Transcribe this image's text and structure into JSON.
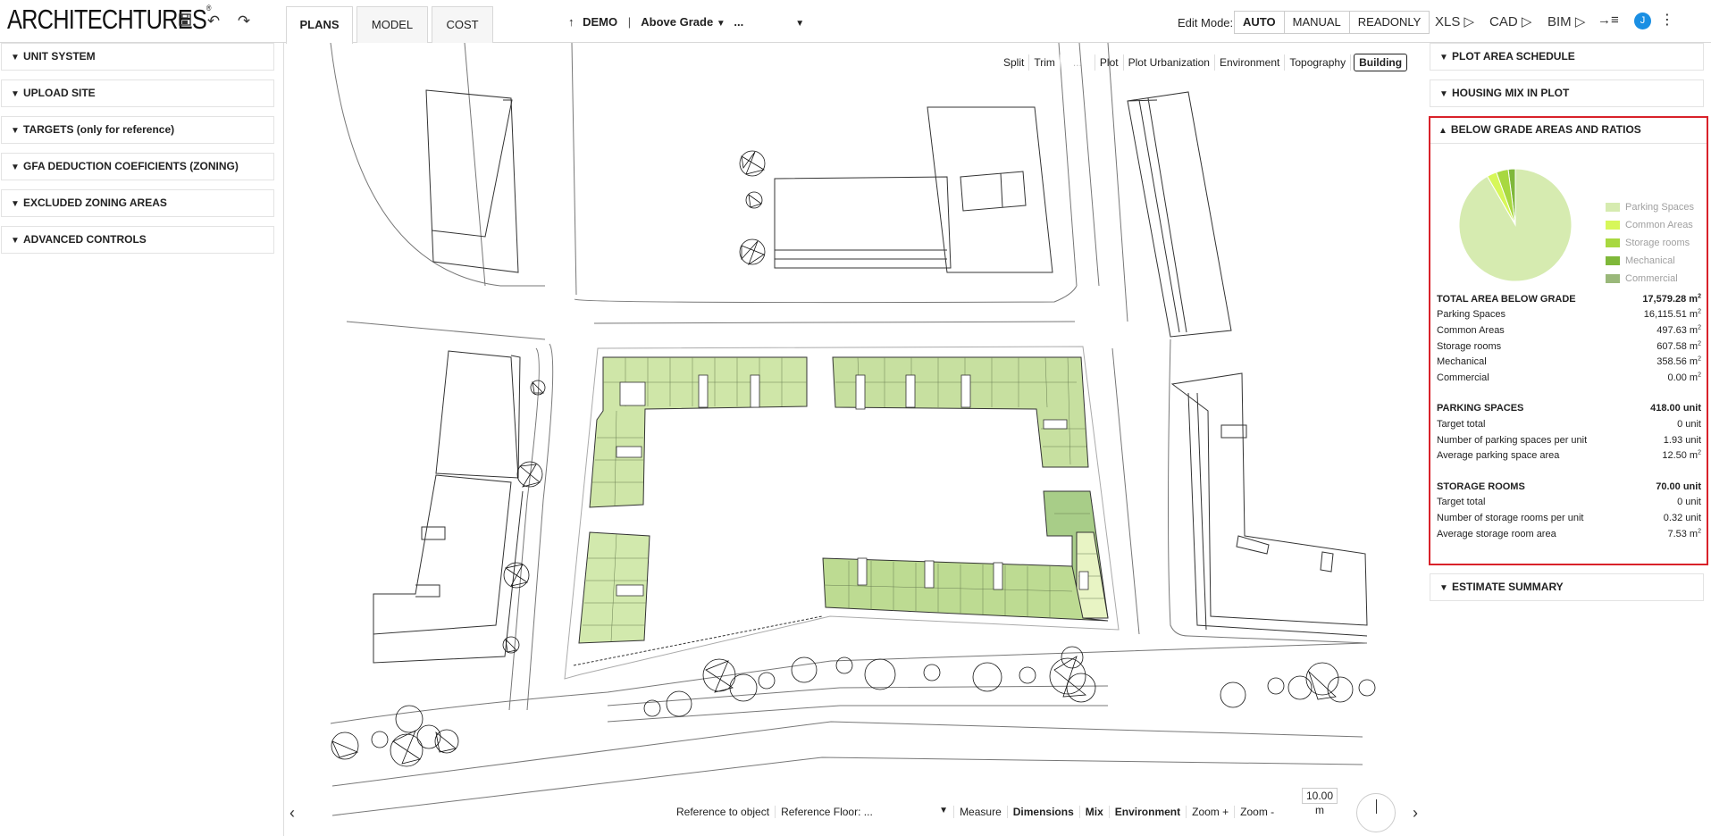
{
  "app": {
    "logo": "ARCHITECHTURES",
    "logo_mark": "®",
    "icons": {
      "save": "save-icon",
      "undo": "undo-icon",
      "redo": "redo-icon"
    }
  },
  "tabs": [
    {
      "label": "PLANS",
      "active": true
    },
    {
      "label": "MODEL",
      "active": false
    },
    {
      "label": "COST",
      "active": false
    }
  ],
  "project": {
    "arrow": "↑",
    "name": "DEMO",
    "separator": "|",
    "level": "Above Grade",
    "sublevel": "..."
  },
  "edit_mode": {
    "label": "Edit Mode:",
    "options": [
      "AUTO",
      "MANUAL",
      "READONLY"
    ],
    "selected": "AUTO"
  },
  "exports": [
    "XLS ▷",
    "CAD ▷",
    "BIM ▷"
  ],
  "user_initial": "J",
  "left_panel": {
    "sections": [
      "UNIT SYSTEM",
      "UPLOAD SITE",
      "TARGETS (only for reference)",
      "GFA DEDUCTION COEFICIENTS (ZONING)",
      "EXCLUDED ZONING AREAS",
      "ADVANCED CONTROLS"
    ]
  },
  "view_toolbar": {
    "items": [
      "Split",
      "Trim",
      "...",
      "Plot",
      "Plot Urbanization",
      "Environment",
      "Topography",
      "Building"
    ],
    "active": "Building"
  },
  "bottom_toolbar": {
    "reference_to_object": "Reference to object",
    "reference_floor_label": "Reference Floor:",
    "reference_floor_value": "...",
    "measure": "Measure",
    "dimensions": "Dimensions",
    "mix": "Mix",
    "environment": "Environment",
    "zoom_in": "Zoom +",
    "zoom_out": "Zoom -",
    "scale_value": "10.00",
    "scale_unit": "m"
  },
  "right_panel": {
    "sections_top": [
      "PLOT AREA SCHEDULE",
      "HOUSING MIX IN PLOT"
    ],
    "below_grade": {
      "title": "BELOW GRADE AREAS AND RATIOS",
      "legend": [
        {
          "label": "Parking Spaces",
          "color": "#d6ebb0"
        },
        {
          "label": "Common Areas",
          "color": "#d7f75a"
        },
        {
          "label": "Storage rooms",
          "color": "#a8d840"
        },
        {
          "label": "Mechanical",
          "color": "#7fb83a"
        },
        {
          "label": "Commercial",
          "color": "#9ab87a"
        }
      ],
      "total": {
        "label": "TOTAL AREA BELOW GRADE",
        "value": "17,579.28 m",
        "unit_sup": "2"
      },
      "areas": [
        {
          "label": "Parking Spaces",
          "value": "16,115.51 m",
          "sup": "2"
        },
        {
          "label": "Common Areas",
          "value": "497.63 m",
          "sup": "2"
        },
        {
          "label": "Storage rooms",
          "value": "607.58 m",
          "sup": "2"
        },
        {
          "label": "Mechanical",
          "value": "358.56 m",
          "sup": "2"
        },
        {
          "label": "Commercial",
          "value": "0.00 m",
          "sup": "2"
        }
      ],
      "parking": {
        "header": {
          "label": "PARKING SPACES",
          "value": "418.00 unit"
        },
        "rows": [
          {
            "label": "Target total",
            "value": "0 unit",
            "sup": ""
          },
          {
            "label": "Number of parking spaces per unit",
            "value": "1.93 unit",
            "sup": ""
          },
          {
            "label": "Average parking space area",
            "value": "12.50 m",
            "sup": "2"
          }
        ]
      },
      "storage": {
        "header": {
          "label": "STORAGE ROOMS",
          "value": "70.00 unit"
        },
        "rows": [
          {
            "label": "Target total",
            "value": "0 unit",
            "sup": ""
          },
          {
            "label": "Number of storage rooms per unit",
            "value": "0.32 unit",
            "sup": ""
          },
          {
            "label": "Average storage room area",
            "value": "7.53 m",
            "sup": "2"
          }
        ]
      },
      "pie_values": [
        16115.51,
        497.63,
        607.58,
        358.56,
        0.0
      ]
    },
    "sections_bottom": [
      "ESTIMATE SUMMARY"
    ]
  }
}
